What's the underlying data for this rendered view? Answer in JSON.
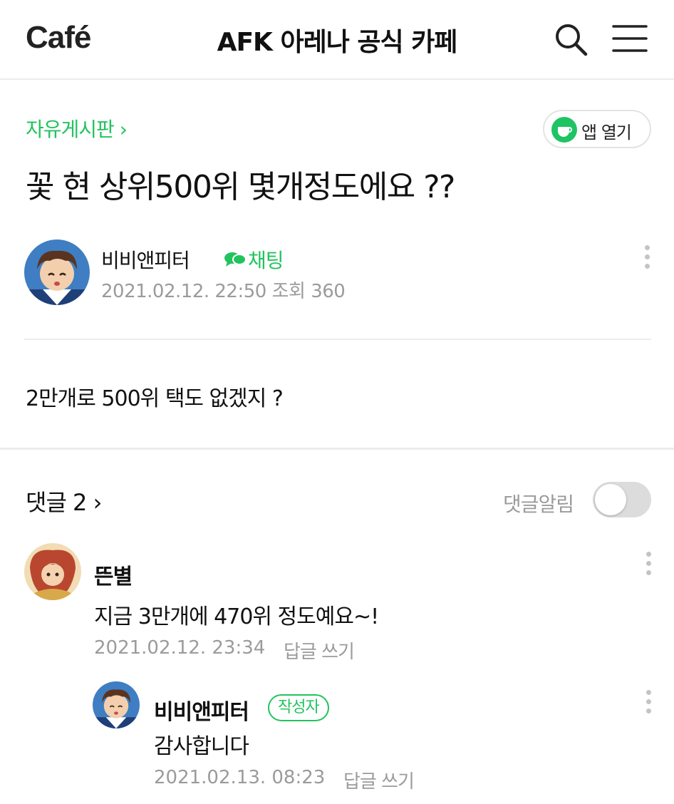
{
  "header": {
    "logo": "Café",
    "cafe_name": "AFK 아레나 공식 카페",
    "search_icon": "search-icon",
    "menu_icon": "hamburger-menu-icon"
  },
  "post": {
    "board": "자유게시판 ›",
    "app_open_label": "앱 열기",
    "title": "꽃 현 상위500위 몇개정도에요 ??",
    "author": "비비앤피터",
    "chat_label": "채팅",
    "date": "2021.02.12. 22:50",
    "views": "조회 360",
    "body": "2만개로 500위 택도 없겠지 ?"
  },
  "comments": {
    "title": "댓글 2 ›",
    "notify_label": "댓글알림",
    "notify_on": false,
    "items": [
      {
        "author": "뜬별",
        "text": "지금 3만개에 470위 정도예요~!",
        "date": "2021.02.12. 23:34",
        "reply": "답글 쓰기"
      },
      {
        "author": "비비앤피터",
        "badge": "작성자",
        "text": "감사합니다",
        "date": "2021.02.13. 08:23",
        "reply": "답글 쓰기"
      }
    ]
  },
  "colors": {
    "accent_green": "#22c35e",
    "muted_text": "#9b9b9b",
    "divider": "#ececec"
  }
}
